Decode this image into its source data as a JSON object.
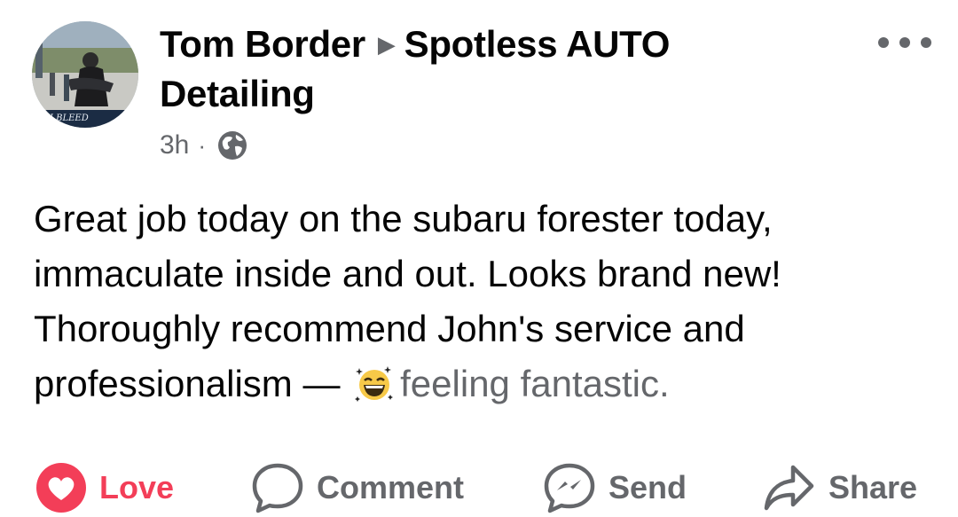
{
  "post": {
    "author": "Tom Border",
    "target": "Spotless AUTO Detailing",
    "time": "3h",
    "privacy_icon": "globe-icon",
    "more_icon": "more-options-icon",
    "body_text": "Great job today on the subaru forester today, immaculate inside and out. Looks brand new! Thoroughly recommend John's service and professionalism —",
    "feeling_text": "feeling fantastic.",
    "feeling_icon": "grinning-stars-emoji-icon"
  },
  "actions": {
    "love_label": "Love",
    "comment_label": "Comment",
    "send_label": "Send",
    "share_label": "Share"
  },
  "colors": {
    "love_red": "#f33e58",
    "secondary_text": "#65676b",
    "primary_text": "#050505"
  }
}
